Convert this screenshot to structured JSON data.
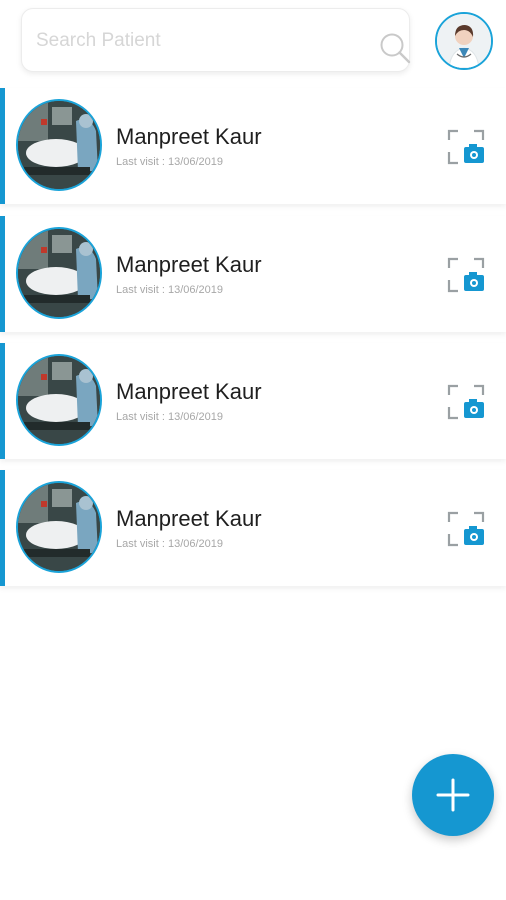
{
  "search": {
    "placeholder": "Search Patient",
    "icon": "search-icon"
  },
  "header": {
    "avatar_icon": "doctor-avatar"
  },
  "patients": [
    {
      "name": "Manpreet Kaur",
      "last_visit": "Last visit : 13/06/2019"
    },
    {
      "name": "Manpreet Kaur",
      "last_visit": "Last visit : 13/06/2019"
    },
    {
      "name": "Manpreet Kaur",
      "last_visit": "Last visit : 13/06/2019"
    },
    {
      "name": "Manpreet Kaur",
      "last_visit": "Last visit : 13/06/2019"
    }
  ],
  "row_action_icon": "scan-camera-icon",
  "fab": {
    "icon": "plus-icon"
  },
  "colors": {
    "accent": "#1597d1",
    "avatar_ring": "#1aa3d9",
    "placeholder": "#d6d6d6",
    "subtext": "#a7a7a7"
  }
}
